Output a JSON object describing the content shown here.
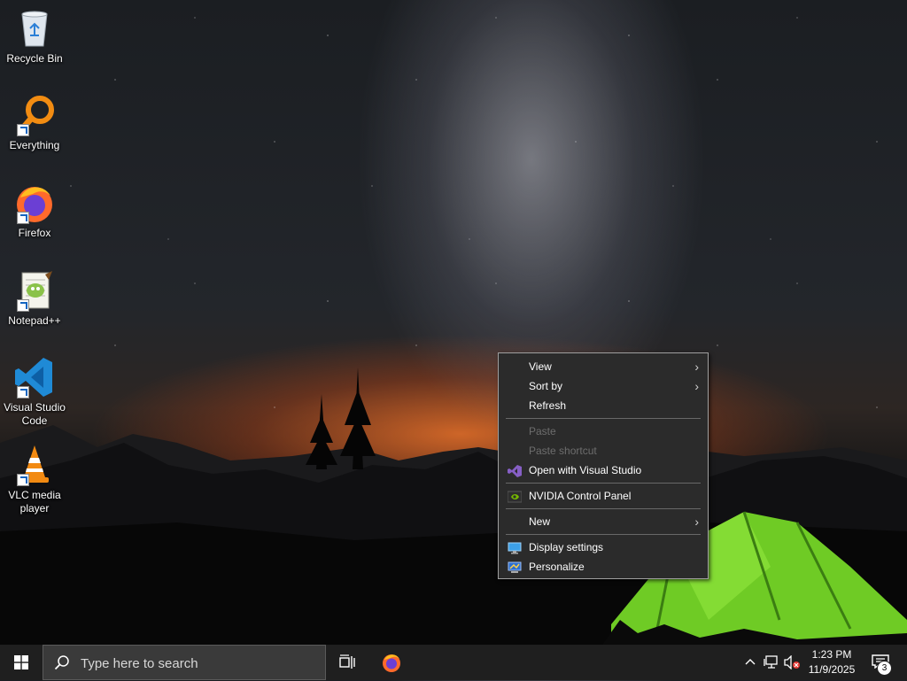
{
  "desktop": {
    "icons": [
      {
        "label": "Recycle Bin"
      },
      {
        "label": "Everything"
      },
      {
        "label": "Firefox"
      },
      {
        "label": "Notepad++"
      },
      {
        "label": "Visual Studio Code"
      },
      {
        "label": "VLC media player"
      }
    ]
  },
  "context_menu": {
    "items": [
      {
        "label": "View",
        "has_submenu": true
      },
      {
        "label": "Sort by",
        "has_submenu": true
      },
      {
        "label": "Refresh"
      },
      {
        "label": "Paste",
        "disabled": true
      },
      {
        "label": "Paste shortcut",
        "disabled": true
      },
      {
        "label": "Open with Visual Studio",
        "icon": "visual-studio-icon"
      },
      {
        "label": "NVIDIA Control Panel",
        "icon": "nvidia-icon"
      },
      {
        "label": "New",
        "has_submenu": true
      },
      {
        "label": "Display settings",
        "icon": "display-icon"
      },
      {
        "label": "Personalize",
        "icon": "personalize-icon"
      }
    ],
    "submenu_arrow": "›"
  },
  "taskbar": {
    "search_placeholder": "Type here to search",
    "clock_time": "1:23 PM",
    "clock_date": "11/9/2025",
    "notification_count": "3"
  },
  "colors": {
    "menu_bg": "#2b2b2b",
    "taskbar_bg": "#1f1f1f",
    "tent_green": "#7bd32a",
    "vs_purple": "#865fc5",
    "nvidia_green": "#76b900"
  }
}
